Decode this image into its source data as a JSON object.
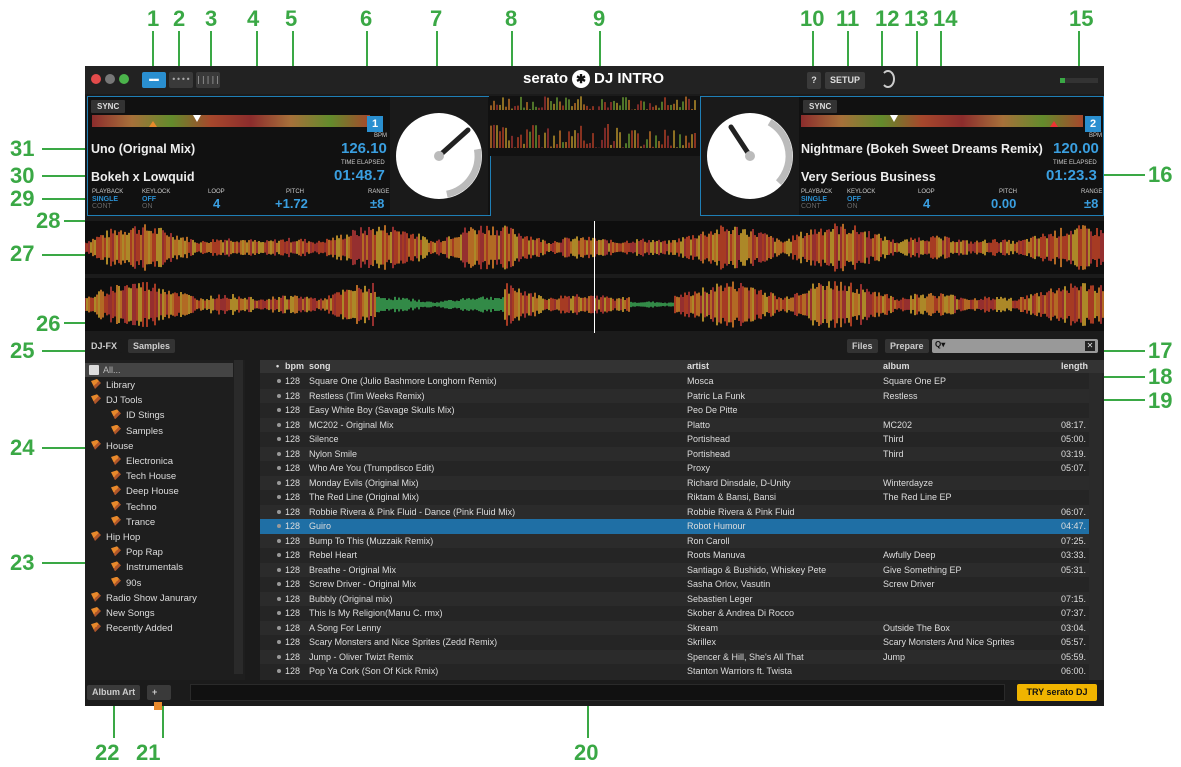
{
  "callouts": [
    "1",
    "2",
    "3",
    "4",
    "5",
    "6",
    "7",
    "8",
    "9",
    "10",
    "11",
    "12",
    "13",
    "14",
    "15",
    "16",
    "17",
    "18",
    "19",
    "20",
    "21",
    "22",
    "23",
    "24",
    "25",
    "26",
    "27",
    "28",
    "29",
    "30",
    "31"
  ],
  "topbar": {
    "logo": "serato",
    "product": "DJ INTRO",
    "help": "?",
    "setup": "SETUP"
  },
  "deck_left": {
    "sync": "SYNC",
    "deck_number": "1",
    "song": "Uno (Orignal Mix)",
    "artist": "Bokeh x Lowquid",
    "bpm_label": "BPM",
    "bpm": "126.10",
    "time_label": "TIME ELAPSED",
    "time": "01:48.7",
    "playback_label": "PLAYBACK",
    "playback_single": "SINGLE",
    "playback_cont": "CONT",
    "keylock_label": "KEYLOCK",
    "keylock_off": "OFF",
    "keylock_on": "ON",
    "loop_label": "LOOP",
    "loop": "4",
    "pitch_label": "PITCH",
    "pitch": "+1.72",
    "range_label": "RANGE",
    "range": "±8"
  },
  "deck_right": {
    "sync": "SYNC",
    "deck_number": "2",
    "song": "Nightmare (Bokeh Sweet Dreams Remix)",
    "artist": "Very Serious Business",
    "bpm_label": "BPM",
    "bpm": "120.00",
    "time_label": "TIME ELAPSED",
    "time": "01:23.3",
    "playback_label": "PLAYBACK",
    "playback_single": "SINGLE",
    "playback_cont": "CONT",
    "keylock_label": "KEYLOCK",
    "keylock_off": "OFF",
    "keylock_on": "ON",
    "loop_label": "LOOP",
    "loop": "4",
    "pitch_label": "PITCH",
    "pitch": "0.00",
    "range_label": "RANGE",
    "range": "±8"
  },
  "panel_tabs": {
    "djfx": "DJ-FX",
    "samples": "Samples",
    "files": "Files",
    "prepare": "Prepare",
    "search_icon": "Q▾"
  },
  "sidebar": {
    "all": "All...",
    "items": [
      {
        "label": "Library",
        "indent": 0
      },
      {
        "label": "DJ Tools",
        "indent": 0
      },
      {
        "label": "ID Stings",
        "indent": 1
      },
      {
        "label": "Samples",
        "indent": 1
      },
      {
        "label": "House",
        "indent": 0
      },
      {
        "label": "Electronica",
        "indent": 1
      },
      {
        "label": "Tech House",
        "indent": 1
      },
      {
        "label": "Deep House",
        "indent": 1
      },
      {
        "label": "Techno",
        "indent": 1
      },
      {
        "label": "Trance",
        "indent": 1
      },
      {
        "label": "Hip Hop",
        "indent": 0
      },
      {
        "label": "Pop Rap",
        "indent": 1
      },
      {
        "label": "Instrumentals",
        "indent": 1
      },
      {
        "label": "90s",
        "indent": 1
      },
      {
        "label": "Radio Show Janurary",
        "indent": 0
      },
      {
        "label": "New Songs",
        "indent": 0
      },
      {
        "label": "Recently Added",
        "indent": 0
      }
    ]
  },
  "columns": {
    "dot": "•",
    "bpm": "bpm",
    "song": "song",
    "artist": "artist",
    "album": "album",
    "length": "length"
  },
  "tracks": [
    {
      "bpm": "128",
      "song": "Square One (Julio Bashmore Longhorn Remix)",
      "artist": "Mosca",
      "album": "Square One EP",
      "length": ""
    },
    {
      "bpm": "128",
      "song": "Restless (Tim Weeks Remix)",
      "artist": "Patric La Funk",
      "album": "Restless",
      "length": ""
    },
    {
      "bpm": "128",
      "song": "Easy White Boy (Savage Skulls Mix)",
      "artist": "Peo De Pitte",
      "album": "",
      "length": ""
    },
    {
      "bpm": "128",
      "song": "MC202 - Original Mix",
      "artist": "Platto",
      "album": "MC202",
      "length": "08:17."
    },
    {
      "bpm": "128",
      "song": "Silence",
      "artist": "Portishead",
      "album": "Third",
      "length": "05:00."
    },
    {
      "bpm": "128",
      "song": "Nylon Smile",
      "artist": "Portishead",
      "album": "Third",
      "length": "03:19."
    },
    {
      "bpm": "128",
      "song": "Who Are You (Trumpdisco Edit)",
      "artist": "Proxy",
      "album": "",
      "length": "05:07."
    },
    {
      "bpm": "128",
      "song": "Monday Evils (Original Mix)",
      "artist": "Richard Dinsdale, D-Unity",
      "album": "Winterdayze",
      "length": ""
    },
    {
      "bpm": "128",
      "song": "The Red Line (Original Mix)",
      "artist": "Riktam & Bansi, Bansi",
      "album": "The Red Line EP",
      "length": ""
    },
    {
      "bpm": "128",
      "song": "Robbie Rivera & Pink Fluid - Dance (Pink Fluid Mix)",
      "artist": "Robbie Rivera & Pink Fluid",
      "album": "",
      "length": "06:07."
    },
    {
      "bpm": "128",
      "song": "Guiro",
      "artist": "Robot Humour",
      "album": "",
      "length": "04:47.",
      "selected": true
    },
    {
      "bpm": "128",
      "song": "Bump To This (Muzzaik Remix)",
      "artist": "Ron Caroll",
      "album": "",
      "length": "07:25."
    },
    {
      "bpm": "128",
      "song": "Rebel Heart",
      "artist": "Roots Manuva",
      "album": "Awfully Deep",
      "length": "03:33."
    },
    {
      "bpm": "128",
      "song": "Breathe - Original Mix",
      "artist": "Santiago & Bushido, Whiskey Pete",
      "album": "Give Something EP",
      "length": "05:31."
    },
    {
      "bpm": "128",
      "song": "Screw Driver - Original Mix",
      "artist": "Sasha Orlov, Vasutin",
      "album": "Screw Driver",
      "length": ""
    },
    {
      "bpm": "128",
      "song": "Bubbly (Original mix)",
      "artist": "Sebastien Leger",
      "album": "",
      "length": "07:15."
    },
    {
      "bpm": "128",
      "song": "This Is My Religion(Manu C. rmx)",
      "artist": "Skober & Andrea Di Rocco",
      "album": "",
      "length": "07:37."
    },
    {
      "bpm": "128",
      "song": "A Song For Lenny",
      "artist": "Skream",
      "album": "Outside The Box",
      "length": "03:04."
    },
    {
      "bpm": "128",
      "song": "Scary Monsters and Nice Sprites (Zedd Remix)",
      "artist": "Skrillex",
      "album": "Scary Monsters And Nice Sprites",
      "length": "05:57."
    },
    {
      "bpm": "128",
      "song": "Jump - Oliver Twizt Remix",
      "artist": "Spencer & Hill, She's All That",
      "album": "Jump",
      "length": "05:59."
    },
    {
      "bpm": "128",
      "song": "Pop Ya Cork (Son Of Kick Rmix)",
      "artist": "Stanton Warriors ft. Twista",
      "album": "",
      "length": "06:00."
    }
  ],
  "bottom": {
    "album_art": "Album Art",
    "add": "+",
    "try": "TRY",
    "try_brand": "serato",
    "try_product": "DJ"
  },
  "colors": {
    "accent": "#2a8fd0",
    "callout": "#3aa845",
    "selected_row": "#1f6fa5",
    "try_button": "#f0b400"
  }
}
